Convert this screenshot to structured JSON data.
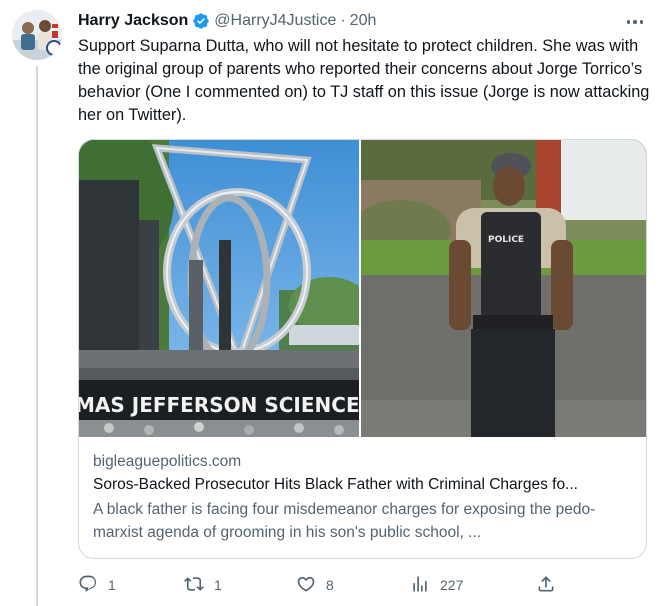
{
  "tweet": {
    "author_name": "Harry Jackson",
    "handle": "@HarryJ4Justice",
    "separator": "·",
    "time": "20h",
    "text": "Support Suparna Dutta, who will not hesitate to protect children. She was with the original group of parents who reported their concerns about Jorge Torrico’s behavior (One I commented on) to TJ staff on this issue (Jorge is now attacking her on Twitter).",
    "image_sign_text": "MAS JEFFERSON SCIENCE",
    "image_badge_text": "POLICE"
  },
  "card": {
    "domain": "bigleaguepolitics.com",
    "title": "Soros-Backed Prosecutor Hits Black Father with Criminal Charges fo...",
    "description": "A black father is facing four misdemeanor charges for exposing the pedo-marxist agenda of grooming in his son's public school, ..."
  },
  "actions": {
    "replies": "1",
    "retweets": "1",
    "likes": "8",
    "views": "227"
  },
  "icons": {
    "verified": "verified-badge-icon",
    "more": "more-options-icon",
    "reply": "reply-icon",
    "retweet": "retweet-icon",
    "like": "heart-icon",
    "views": "views-icon",
    "share": "share-icon"
  },
  "colors": {
    "verified_blue": "#1d9bf0",
    "text_primary": "#0f1419",
    "text_secondary": "#536471",
    "border": "#cfd9de"
  }
}
